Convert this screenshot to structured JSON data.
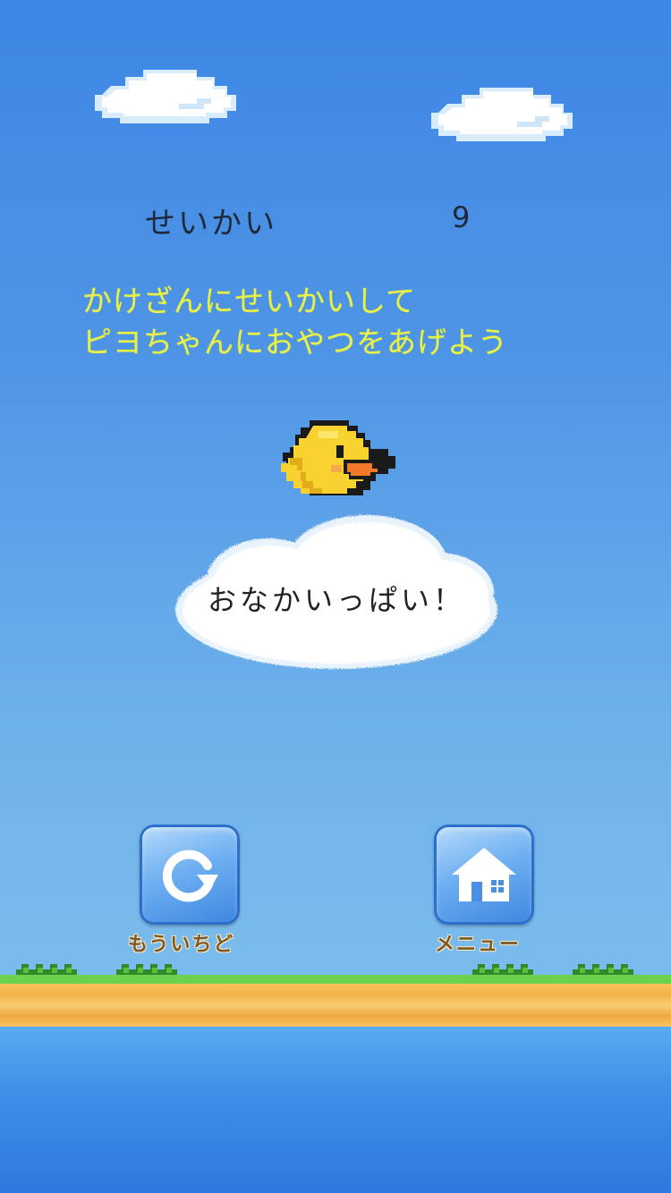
{
  "score": {
    "label": "せいかい",
    "value": "9"
  },
  "instruction": {
    "line1": "かけざんにせいかいして",
    "line2": "ピヨちゃんにおやつをあげよう"
  },
  "message": "おなかいっぱい！",
  "buttons": {
    "retry": {
      "label": "もういちど",
      "icon": "retry-icon"
    },
    "menu": {
      "label": "メニュー",
      "icon": "house-icon"
    }
  },
  "colors": {
    "instruction_text": "#e8f04a",
    "button_label": "#7a5a2a",
    "sky_top": "#3d86e4",
    "sky_bottom": "#7cbdec"
  }
}
